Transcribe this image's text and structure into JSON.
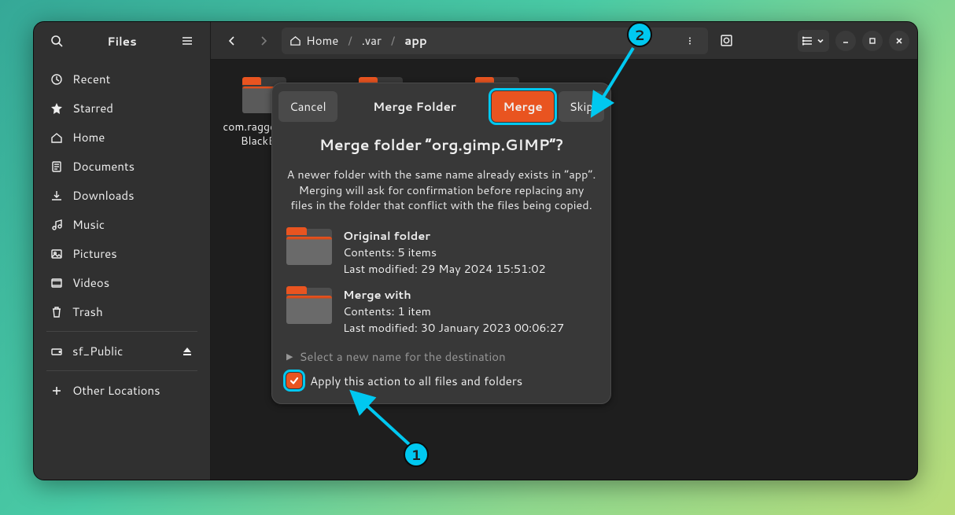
{
  "window": {
    "title": "Files"
  },
  "sidebar": {
    "items": [
      {
        "label": "Recent"
      },
      {
        "label": "Starred"
      },
      {
        "label": "Home"
      },
      {
        "label": "Documents"
      },
      {
        "label": "Downloads"
      },
      {
        "label": "Music"
      },
      {
        "label": "Pictures"
      },
      {
        "label": "Videos"
      },
      {
        "label": "Trash"
      }
    ],
    "mount": {
      "label": "sf_Public"
    },
    "other": {
      "label": "Other Locations"
    }
  },
  "breadcrumb": {
    "home": "Home",
    "seg1": ".var",
    "seg2": "app"
  },
  "folders": [
    {
      "label": "com.raggesilver.BlackBox"
    }
  ],
  "dialog": {
    "cancel": "Cancel",
    "header_title": "Merge Folder",
    "merge": "Merge",
    "skip": "Skip",
    "heading": "Merge folder “org.gimp.GIMP”?",
    "paragraph": "A newer folder with the same name already exists in “app”. Merging will ask for confirmation before replacing any files in the folder that conflict with the files being copied.",
    "original": {
      "title": "Original folder",
      "contents": "Contents: 5 items",
      "modified": "Last modified: 29 May 2024 15:51:02"
    },
    "mergewith": {
      "title": "Merge with",
      "contents": "Contents: 1 item",
      "modified": "Last modified: 30 January 2023 00:06:27"
    },
    "select_label": "Select a new name for the destination",
    "apply_label": "Apply this action to all files and folders"
  },
  "anno": {
    "badge1": "1",
    "badge2": "2"
  }
}
